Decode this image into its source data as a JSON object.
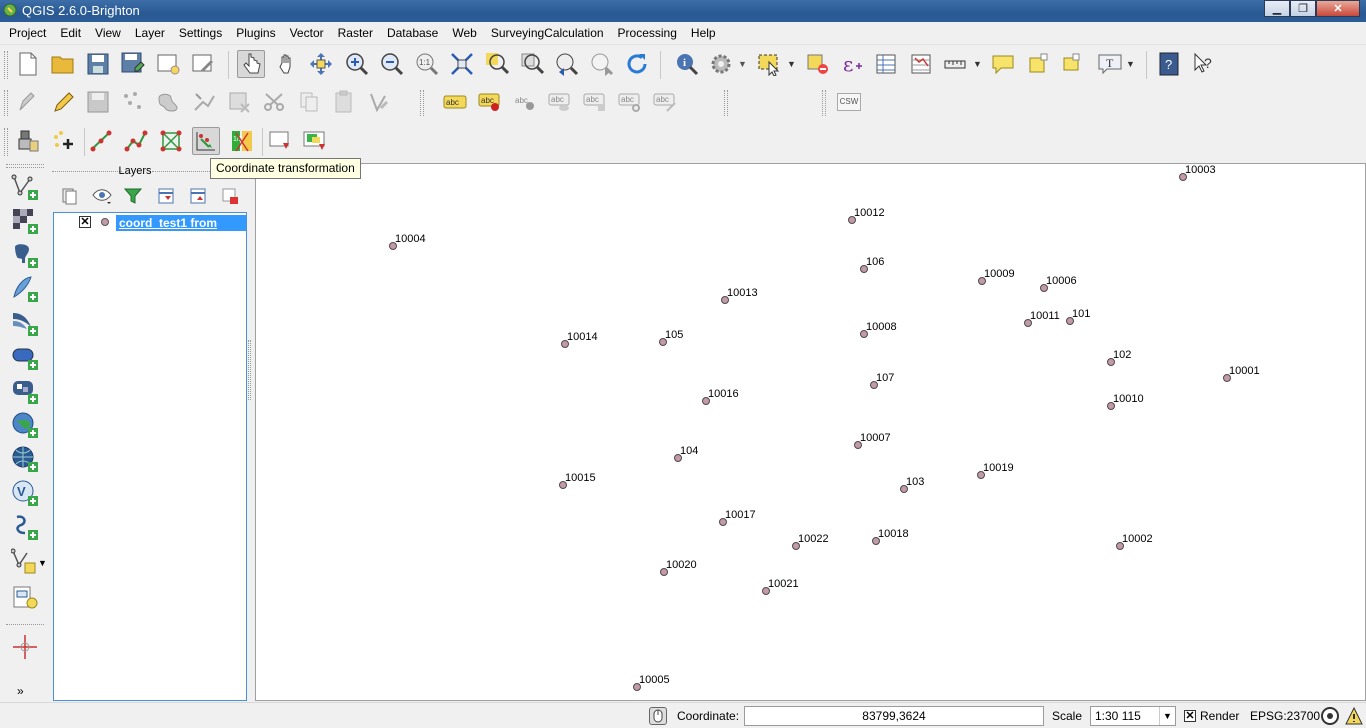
{
  "window": {
    "title": "QGIS 2.6.0-Brighton"
  },
  "menubar": [
    "Project",
    "Edit",
    "View",
    "Layer",
    "Settings",
    "Plugins",
    "Vector",
    "Raster",
    "Database",
    "Web",
    "SurveyingCalculation",
    "Processing",
    "Help"
  ],
  "tooltip": {
    "text": "Coordinate transformation"
  },
  "toolbar3": {
    "csw_label": "CSW"
  },
  "layers_panel": {
    "title": "Layers",
    "layers": [
      {
        "name": "coord_test1 from",
        "visible": true
      }
    ]
  },
  "map_points": [
    {
      "label": "10003"
    },
    {
      "label": "10012"
    },
    {
      "label": "10004"
    },
    {
      "label": "106"
    },
    {
      "label": "10009"
    },
    {
      "label": "10006"
    },
    {
      "label": "10013"
    },
    {
      "label": "10011"
    },
    {
      "label": "101"
    },
    {
      "label": "10008"
    },
    {
      "label": "10014"
    },
    {
      "label": "105"
    },
    {
      "label": "102"
    },
    {
      "label": "10001"
    },
    {
      "label": "107"
    },
    {
      "label": "10016"
    },
    {
      "label": "10010"
    },
    {
      "label": "10007"
    },
    {
      "label": "104"
    },
    {
      "label": "10019"
    },
    {
      "label": "10015"
    },
    {
      "label": "103"
    },
    {
      "label": "10017"
    },
    {
      "label": "10022"
    },
    {
      "label": "10018"
    },
    {
      "label": "10002"
    },
    {
      "label": "10020"
    },
    {
      "label": "10021"
    },
    {
      "label": "10005"
    }
  ],
  "statusbar": {
    "coordinate_label": "Coordinate:",
    "coordinate_value": "83799,3624",
    "scale_label": "Scale",
    "scale_value": "1:30 115",
    "render_label": "Render",
    "render_checked": true,
    "crs": "EPSG:23700"
  },
  "colors": {
    "titlebar": "#2b5c97",
    "selection": "#3399ff",
    "point_fill": "#c39aa6",
    "tooltip_bg": "#ffffe1"
  }
}
